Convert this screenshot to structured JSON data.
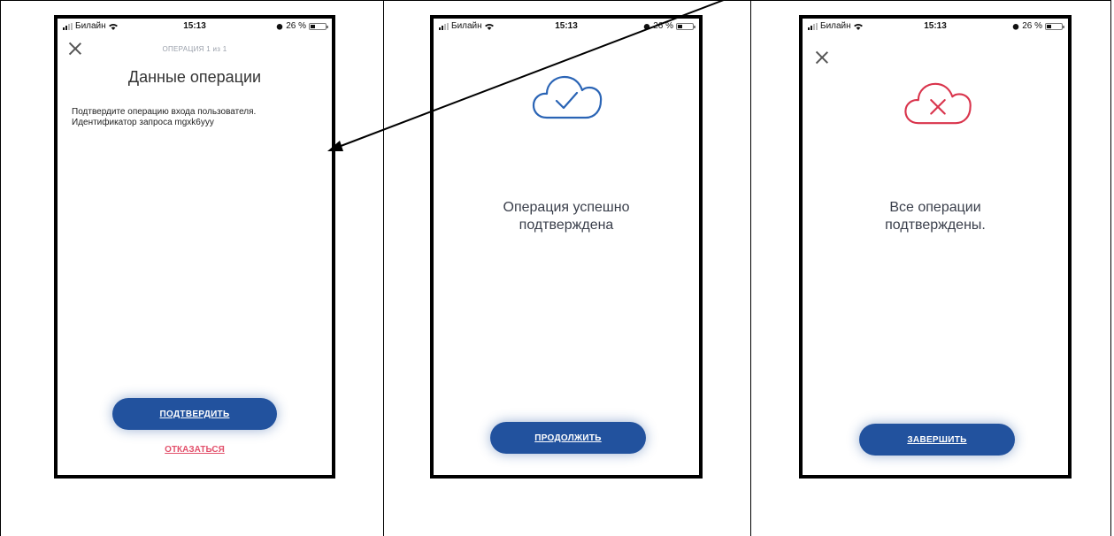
{
  "status_bar": {
    "carrier": "Билайн",
    "time": "15:13",
    "battery": "26 %"
  },
  "panel1": {
    "counter": "ОПЕРАЦИЯ 1 из 1",
    "title": "Данные операции",
    "desc_line1": "Подтвердите операцию входа пользователя.",
    "desc_line2": "Идентификатор запроса mgxk6yyy",
    "confirm_label": "ПОДТВЕРДИТЬ",
    "reject_label": "ОТКАЗАТЬСЯ"
  },
  "panel2": {
    "message_line1": "Операция успешно",
    "message_line2": "подтверждена",
    "continue_label": "ПРОДОЛЖИТЬ"
  },
  "panel3": {
    "message_line1": "Все операции",
    "message_line2": "подтверждены.",
    "finish_label": "ЗАВЕРШИТЬ"
  },
  "colors": {
    "primary_button": "#22529e",
    "cloud_blue": "#2a64b5",
    "cloud_red": "#d9344c",
    "reject_link": "#e2506b"
  },
  "icons": [
    "close-icon",
    "cloud-check-icon",
    "cloud-error-icon",
    "wifi-icon",
    "signal-icon",
    "battery-icon",
    "alarm-icon"
  ]
}
